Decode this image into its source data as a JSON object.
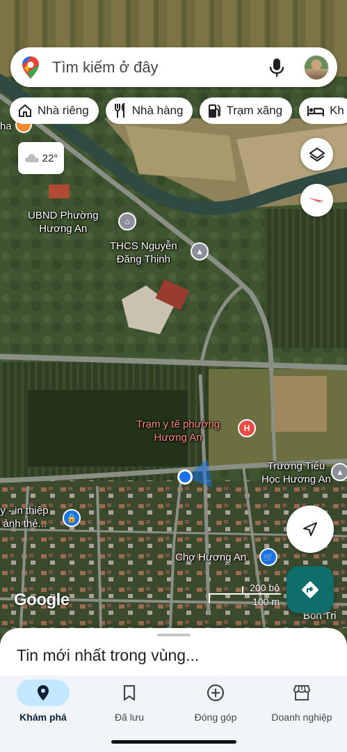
{
  "search": {
    "placeholder": "Tìm kiếm ở đây"
  },
  "chips": [
    {
      "label": "Nhà riêng",
      "icon": "home-icon"
    },
    {
      "label": "Nhà hàng",
      "icon": "restaurant-icon"
    },
    {
      "label": "Trạm xăng",
      "icon": "gas-station-icon"
    },
    {
      "label": "Kh",
      "icon": "hotel-icon"
    }
  ],
  "weather": {
    "temp": "22°",
    "icon": "cloud-icon"
  },
  "map": {
    "type": "satellite",
    "places": [
      {
        "name": "UBND Phường\nHương An",
        "icon": "government-icon"
      },
      {
        "name": "THCS Nguyễn\nĐăng Thịnh",
        "icon": "school-icon"
      },
      {
        "name": "Trạm y tế phường\nHương An",
        "icon": "hospital-icon"
      },
      {
        "name": "Trường Tiểu\nHọc Hương An",
        "icon": "school-icon"
      },
      {
        "name": "Chợ Hương An",
        "icon": "shopping-cart-icon"
      },
      {
        "name": "py - in thiệp\np ảnh thẻ...",
        "icon": "shopping-bag-icon"
      },
      {
        "name": "Bon Tri",
        "icon": ""
      },
      {
        "name": "ha",
        "icon": ""
      }
    ],
    "scale": {
      "imperial": "200 bộ",
      "metric": "100 m"
    },
    "attribution": "Google",
    "colors": {
      "road": "#8a8f86",
      "water": "#2f4a43",
      "location_dot": "#1a73e8",
      "hospital": "#e94b46",
      "school": "#8a8f99"
    }
  },
  "sheet": {
    "title": "Tin mới nhất trong vùng..."
  },
  "nav": [
    {
      "label": "Khám phá",
      "icon": "location-pin-icon",
      "active": true
    },
    {
      "label": "Đã lưu",
      "icon": "bookmark-icon",
      "active": false
    },
    {
      "label": "Đóng góp",
      "icon": "add-circle-icon",
      "active": false
    },
    {
      "label": "Doanh nghiệp",
      "icon": "storefront-icon",
      "active": false
    }
  ]
}
